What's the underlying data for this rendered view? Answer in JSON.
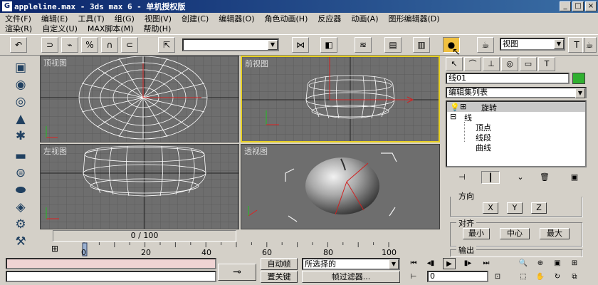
{
  "title": "appleline.max - 3ds max 6 - 单机授权版",
  "menu1": [
    "文件(F)",
    "编辑(E)",
    "工具(T)",
    "组(G)",
    "视图(V)",
    "创建(C)",
    "编辑器(O)",
    "角色动画(H)",
    "反应器",
    "动画(A)",
    "图形编辑器(D)"
  ],
  "menu2": [
    "渲染(R)",
    "自定义(U)",
    "MAX脚本(M)",
    "帮助(H)"
  ],
  "toolbar": {
    "view_select": "视图"
  },
  "viewports": {
    "top": "顶视图",
    "front": "前视图",
    "left": "左视图",
    "persp": "透视图"
  },
  "command_panel": {
    "object_name": "线01",
    "object_color": "#30b030",
    "modifier_list": "编辑集列表",
    "stack": [
      "旋转",
      "线",
      "顶点",
      "线段",
      "曲线"
    ],
    "align_axis_labels": [
      "X",
      "Y",
      "Z"
    ],
    "align_group": "对齐",
    "align_buttons": [
      "最小",
      "中心",
      "最大"
    ],
    "output_group": "输出",
    "partial_group": "方向"
  },
  "timeline": {
    "slider": "0 / 100",
    "ticks": [
      "0",
      "20",
      "40",
      "60",
      "80",
      "100"
    ]
  },
  "status": {
    "auto_key": "自动帧",
    "set_key": "置关键",
    "selection_dropdown": "所选择的",
    "key_filters": "帧过滤器...",
    "frame": "0"
  }
}
